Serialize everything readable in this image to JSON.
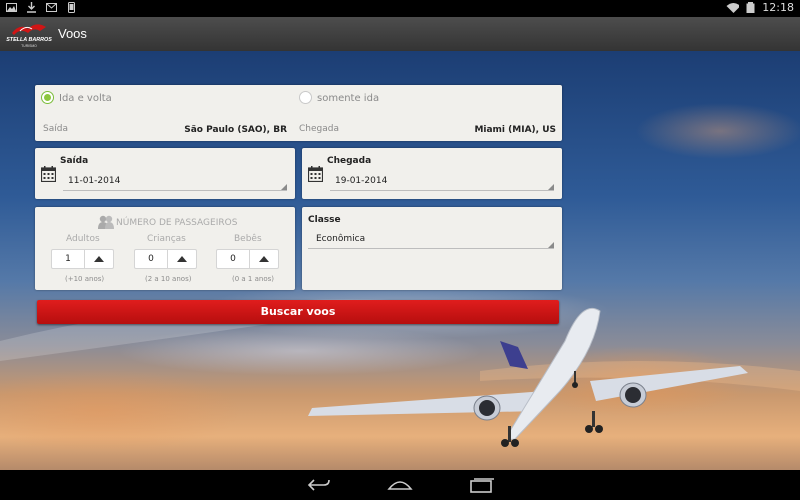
{
  "status_bar": {
    "left_icons": [
      "gallery-icon",
      "download-icon",
      "gmail-icon",
      "phone-icon"
    ],
    "right_icons": [
      "wifi-icon",
      "battery-icon"
    ],
    "time": "12:18"
  },
  "action_bar": {
    "logo_text": "STELLA BARROS TURISMO",
    "title": "Voos"
  },
  "trip_type": {
    "round_trip_label": "Ida e volta",
    "one_way_label": "somente ida",
    "selected": "round_trip"
  },
  "route": {
    "origin_label": "Saída",
    "origin_value": "São Paulo (SAO), BR",
    "destination_label": "Chegada",
    "destination_value": "Miami (MIA), US"
  },
  "dates": {
    "departure_label": "Saída",
    "departure_value": "11-01-2014",
    "return_label": "Chegada",
    "return_value": "19-01-2014"
  },
  "passengers": {
    "title": "NÚMERO DE PASSAGEIROS",
    "adults": {
      "label": "Adultos",
      "value": "1",
      "hint": "(+10 anos)"
    },
    "children": {
      "label": "Crianças",
      "value": "0",
      "hint": "(2 a 10 anos)"
    },
    "babies": {
      "label": "Bebês",
      "value": "0",
      "hint": "(0 a 1 anos)"
    }
  },
  "cabin": {
    "label": "Classe",
    "value": "Econômica"
  },
  "search_button": "Buscar voos",
  "nav_bar": [
    "back-icon",
    "home-icon",
    "recents-icon"
  ],
  "colors": {
    "accent_red": "#d01515",
    "radio_green": "#8cc63f",
    "card_bg": "#f1f0ec"
  }
}
